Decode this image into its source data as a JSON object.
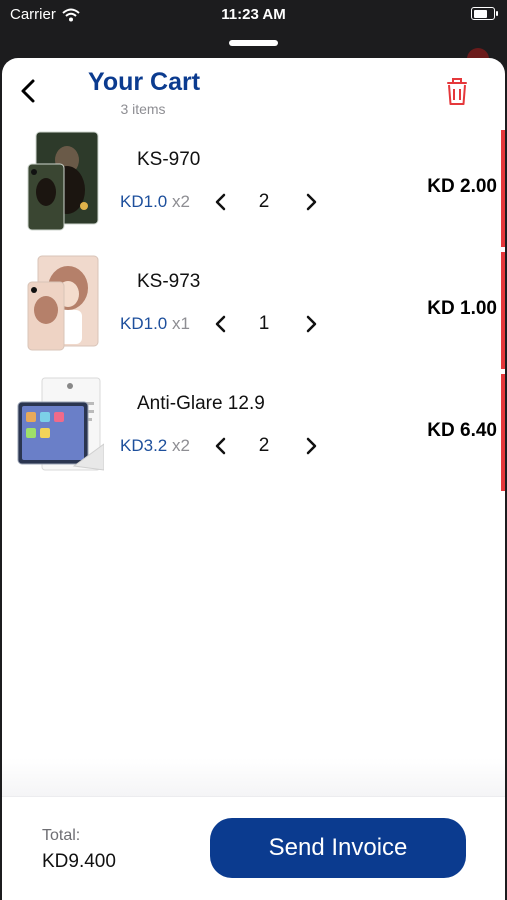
{
  "status_bar": {
    "carrier": "Carrier",
    "time": "11:23 AM",
    "battery_level": 0.85
  },
  "header": {
    "title": "Your Cart",
    "subtitle": "3 items"
  },
  "icons": {
    "back": "chevron-left-icon",
    "trash": "trash-icon",
    "decrement": "chevron-left-icon",
    "increment": "chevron-right-icon",
    "wifi": "wifi-icon"
  },
  "colors": {
    "brand_blue": "#0b3b8f",
    "price_blue": "#1d4f9c",
    "trash_red": "#e5383b"
  },
  "items": [
    {
      "name": "KS-970",
      "unit_price": "KD1.0",
      "unit_qty": "x2",
      "quantity": "2",
      "total": "KD 2.00"
    },
    {
      "name": "KS-973",
      "unit_price": "KD1.0",
      "unit_qty": "x1",
      "quantity": "1",
      "total": "KD 1.00"
    },
    {
      "name": "Anti-Glare 12.9",
      "unit_price": "KD3.2",
      "unit_qty": "x2",
      "quantity": "2",
      "total": "KD 6.40"
    }
  ],
  "footer": {
    "total_label": "Total:",
    "total_value": "KD9.400",
    "send_button": "Send Invoice"
  }
}
